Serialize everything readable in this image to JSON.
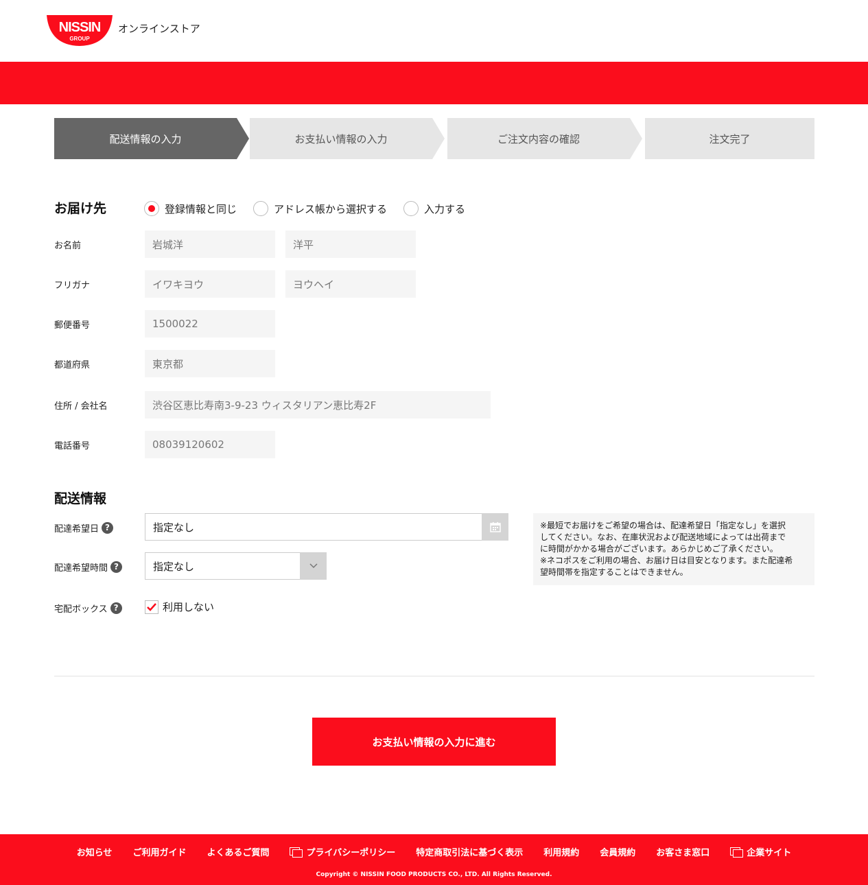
{
  "header": {
    "logo_text": "NISSIN",
    "logo_sub": "GROUP",
    "store_name": "オンラインストア"
  },
  "steps": [
    {
      "label": "配送情報の入力",
      "state": "active"
    },
    {
      "label": "お支払い情報の入力",
      "state": "inactive"
    },
    {
      "label": "ご注文内容の確認",
      "state": "inactive"
    },
    {
      "label": "注文完了",
      "state": "inactive"
    }
  ],
  "destination": {
    "title": "お届け先",
    "options": [
      {
        "label": "登録情報と同じ",
        "checked": true
      },
      {
        "label": "アドレス帳から選択する",
        "checked": false
      },
      {
        "label": "入力する",
        "checked": false
      }
    ],
    "fields": {
      "name_label": "お名前",
      "last_name": "岩城洋",
      "first_name": "洋平",
      "kana_label": "フリガナ",
      "last_kana": "イワキヨウ",
      "first_kana": "ヨウヘイ",
      "postal_label": "郵便番号",
      "postal": "1500022",
      "pref_label": "都道府県",
      "pref": "東京都",
      "address_label": "住所 / 会社名",
      "address": "渋谷区恵比寿南3-9-23 ウィスタリアン恵比寿2F",
      "phone_label": "電話番号",
      "phone": "08039120602"
    }
  },
  "delivery": {
    "title": "配送情報",
    "date_label": "配達希望日",
    "date_value": "指定なし",
    "time_label": "配達希望時間",
    "time_value": "指定なし",
    "box_label": "宅配ボックス",
    "box_checkbox_label": "利用しない",
    "box_checked": true,
    "note_lines": [
      "※最短でお届けをご希望の場合は、配達希望日「指定なし」を選択",
      "してください。なお、在庫状況および配送地域によっては出荷まで",
      "に時間がかかる場合がございます。あらかじめご了承ください。",
      "※ネコポスをご利用の場合、お届け日は目安となります。また配達希",
      "望時間帯を指定することはできません。"
    ],
    "help_symbol": "?"
  },
  "submit_label": "お支払い情報の入力に進む",
  "footer": {
    "links": [
      {
        "label": "お知らせ",
        "external": false
      },
      {
        "label": "ご利用ガイド",
        "external": false
      },
      {
        "label": "よくあるご質問",
        "external": false
      },
      {
        "label": "プライバシーポリシー",
        "external": true
      },
      {
        "label": "特定商取引法に基づく表示",
        "external": false
      },
      {
        "label": "利用規約",
        "external": false
      },
      {
        "label": "会員規約",
        "external": false
      },
      {
        "label": "お客さま窓口",
        "external": false
      },
      {
        "label": "企業サイト",
        "external": true
      }
    ],
    "copyright": "Copyright © NISSIN FOOD PRODUCTS CO., LTD. All Rights Reserved."
  },
  "colors": {
    "brand_red": "#fb0d1c",
    "active_step": "#666666",
    "inactive_step": "#e6e6e6"
  }
}
